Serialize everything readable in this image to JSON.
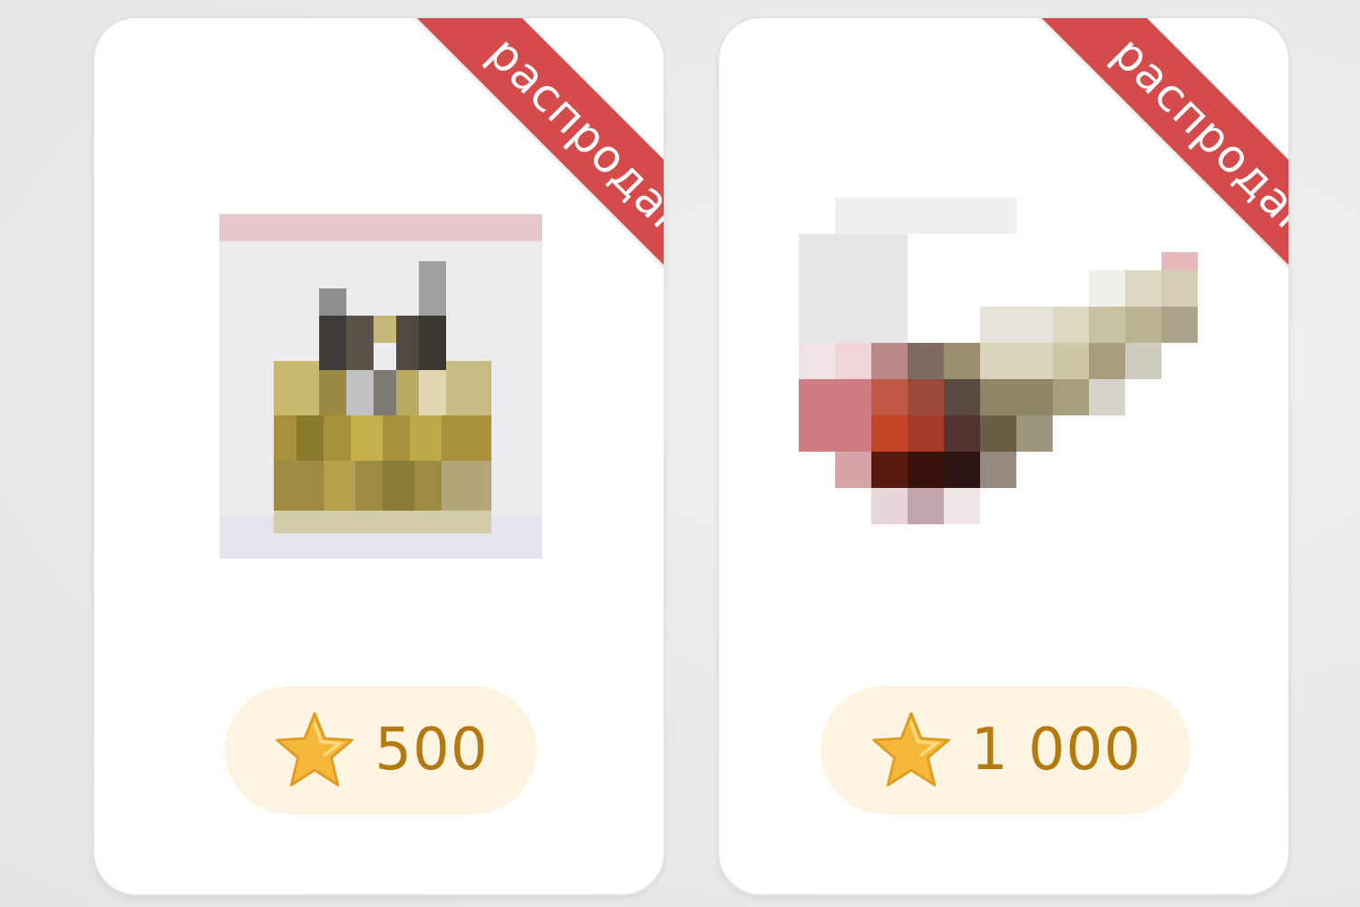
{
  "items": [
    {
      "ribbon_label": "распродан",
      "price": "500",
      "currency_icon": "star-icon",
      "image_icon": "pixelated-product-image"
    },
    {
      "ribbon_label": "распродан",
      "price": "1 000",
      "currency_icon": "star-icon",
      "image_icon": "pixelated-product-image"
    }
  ],
  "colors": {
    "ribbon": "#d54a4a",
    "price_text": "#b47a10",
    "price_pill": "#fdf5e2",
    "star": "#f4b73a",
    "card": "#ffffff",
    "background": "#ececec"
  }
}
